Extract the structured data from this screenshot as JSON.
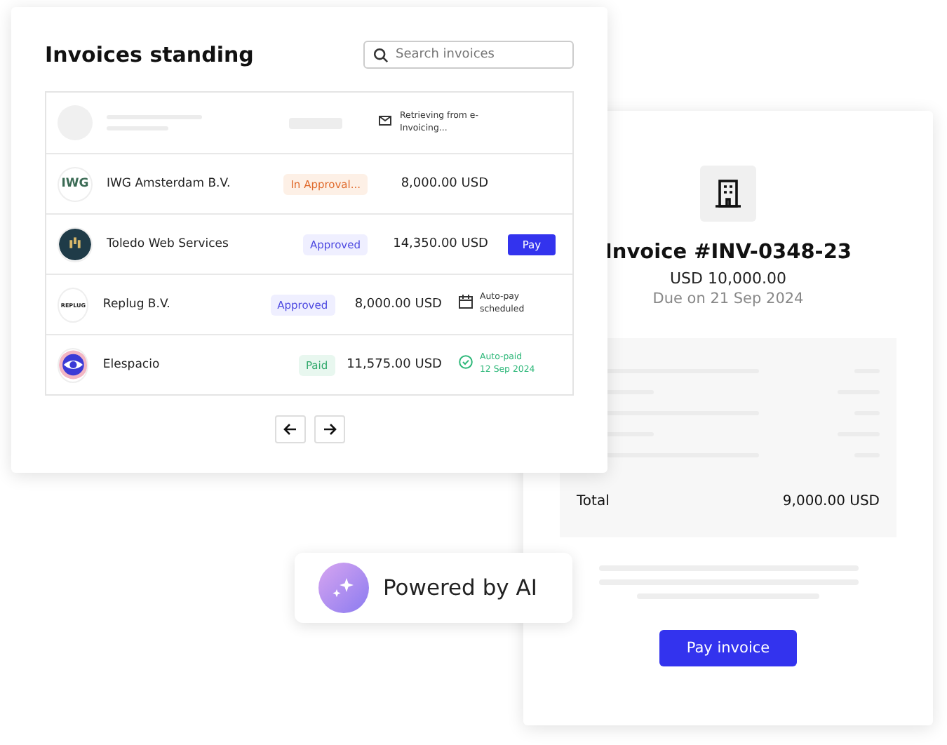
{
  "invoices_panel": {
    "title": "Invoices standing",
    "search": {
      "placeholder": "Search invoices"
    },
    "rows": [
      {
        "kind": "loading",
        "action": {
          "kind": "retrieving",
          "text": "Retrieving from e-Invoicing..."
        }
      },
      {
        "kind": "invoice",
        "logo": {
          "kind": "text",
          "text": "IWG"
        },
        "name": "IWG Amsterdam B.V.",
        "status": {
          "kind": "pending",
          "text": "In Approval..."
        },
        "amount": "8,000.00 USD"
      },
      {
        "kind": "invoice",
        "logo": {
          "kind": "bars"
        },
        "name": "Toledo Web Services",
        "status": {
          "kind": "approved",
          "text": "Approved"
        },
        "amount": "14,350.00 USD",
        "action": {
          "kind": "pay",
          "text": "Pay"
        }
      },
      {
        "kind": "invoice",
        "logo": {
          "kind": "text",
          "text": "REPLUG"
        },
        "name": "Replug B.V.",
        "status": {
          "kind": "approved",
          "text": "Approved"
        },
        "amount": "8,000.00 USD",
        "action": {
          "kind": "scheduled",
          "text": "Auto-pay scheduled"
        }
      },
      {
        "kind": "invoice",
        "logo": {
          "kind": "eye"
        },
        "name": "Elespacio",
        "status": {
          "kind": "paid",
          "text": "Paid"
        },
        "amount": "11,575.00 USD",
        "action": {
          "kind": "paid",
          "text": "Auto-paid",
          "date": "12 Sep 2024"
        }
      }
    ]
  },
  "invoice_card": {
    "title": "Invoice #INV-0348-23",
    "amount": "USD 10,000.00",
    "due": "Due on 21 Sep 2024",
    "total_label": "Total",
    "total": "9,000.00 USD",
    "button": "Pay invoice"
  },
  "ai_badge": {
    "text": "Powered by AI"
  }
}
